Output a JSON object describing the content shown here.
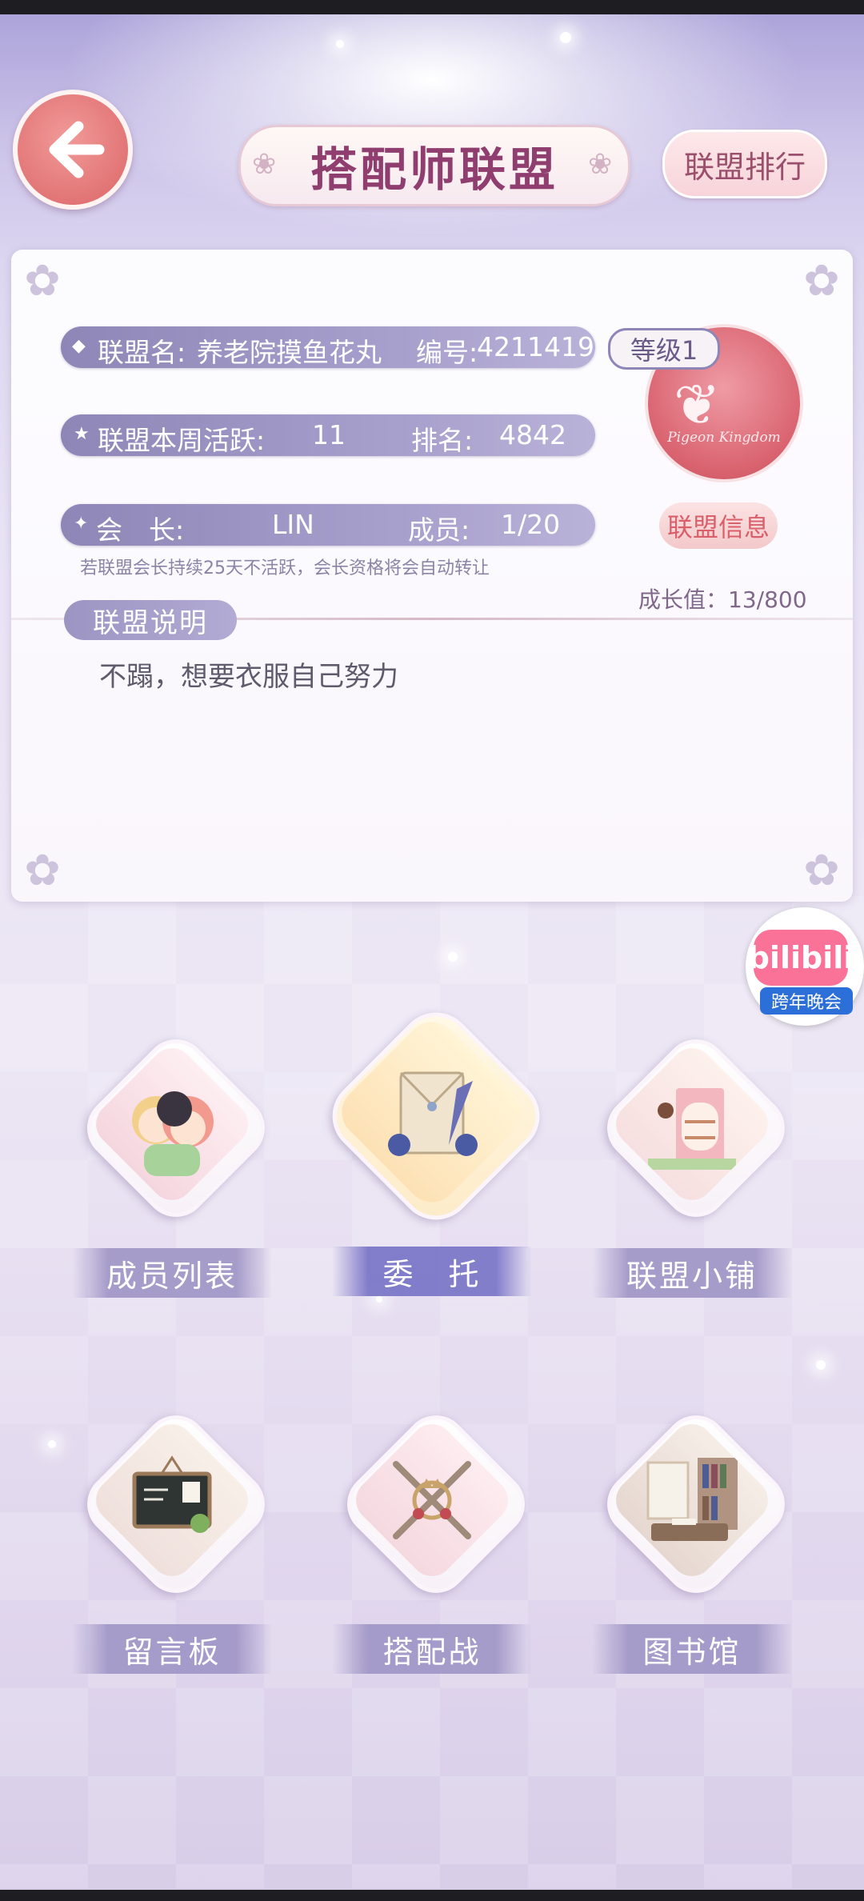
{
  "header": {
    "title": "搭配师联盟",
    "rank_button": "联盟排行"
  },
  "alliance": {
    "name_label": "联盟名:",
    "name": "养老院摸鱼花丸",
    "id_label": "编号:",
    "id": "4211419",
    "activity_label": "联盟本周活跃:",
    "activity": "11",
    "rank_label": "排名:",
    "rank": "4842",
    "leader_label": "会　长:",
    "leader": "LIN",
    "members_label": "成员:",
    "members": "1/20",
    "level": "等级1",
    "emblem_text": "Pigeon Kingdom",
    "info_button": "联盟信息",
    "note": "若联盟会长持续25天不活跃，会长资格将会自动转让",
    "growth": "成长值：13/800",
    "desc_label": "联盟说明",
    "description": "不蹋，想要衣服自己努力"
  },
  "bilibili": {
    "logo": "bilibili",
    "badge": "跨年晚会"
  },
  "menu": {
    "members": "成员列表",
    "commission": "委　托",
    "shop": "联盟小铺",
    "board": "留言板",
    "battle": "搭配战",
    "library": "图书馆"
  },
  "colors": {
    "accent_purple": "#9c94c2",
    "title_text": "#8f3e6f",
    "back_button": "#e27576"
  }
}
